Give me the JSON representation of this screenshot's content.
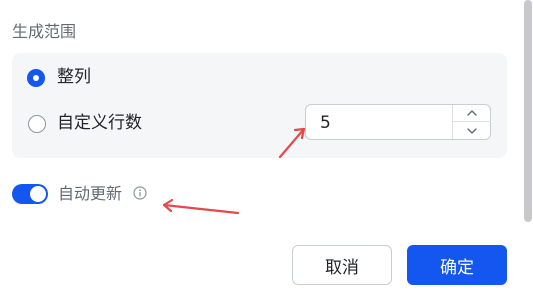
{
  "section": {
    "title": "生成范围"
  },
  "options": {
    "items": [
      {
        "label": "整列",
        "selected": true
      },
      {
        "label": "自定义行数",
        "selected": false
      }
    ],
    "row_count_value": "5"
  },
  "auto_update": {
    "label": "自动更新",
    "enabled": true,
    "info_icon": "info-circle-icon"
  },
  "footer": {
    "cancel_label": "取消",
    "confirm_label": "确定"
  },
  "colors": {
    "accent": "#1456f0",
    "annotation_arrow": "#e5484d",
    "panel_bg": "#f5f6f7"
  }
}
